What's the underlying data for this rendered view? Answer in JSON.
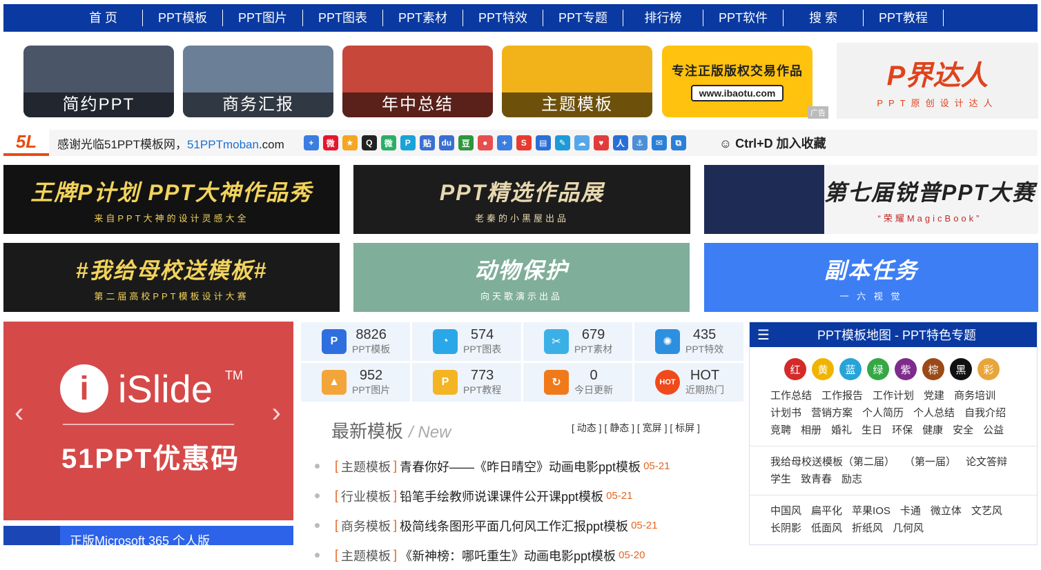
{
  "nav": [
    "首 页",
    "PPT模板",
    "PPT图片",
    "PPT图表",
    "PPT素材",
    "PPT特效",
    "PPT专题",
    "排行榜",
    "PPT软件",
    "搜 索",
    "PPT教程"
  ],
  "promos": [
    {
      "caption": "简约PPT",
      "color": "#4a5568"
    },
    {
      "caption": "商务汇报",
      "color": "#6b7f96"
    },
    {
      "caption": "年中总结",
      "color": "#c7473b"
    },
    {
      "caption": "主题模板",
      "color": "#f2b31a"
    }
  ],
  "ibaotu": {
    "title": "专注正版版权交易作品",
    "url": "www.ibaotu.com",
    "ad": "广告"
  },
  "pjdr": {
    "logo": "P界达人",
    "sub": "PPT原创设计达人"
  },
  "welcome": {
    "logo": "5L",
    "text": "感谢光临51PPT模板网，",
    "domain_colored": "51PPTmoban",
    "domain_tail": ".com",
    "favorite": "Ctrl+D 加入收藏"
  },
  "share_icons": [
    {
      "name": "plus-icon",
      "glyph": "+",
      "color": "#3b7de0"
    },
    {
      "name": "weibo-icon",
      "glyph": "微",
      "color": "#e6162d"
    },
    {
      "name": "star-icon",
      "glyph": "★",
      "color": "#f5a623"
    },
    {
      "name": "qq-icon",
      "glyph": "Q",
      "color": "#222"
    },
    {
      "name": "wechat-icon",
      "glyph": "微",
      "color": "#2aae67"
    },
    {
      "name": "p-icon",
      "glyph": "P",
      "color": "#1aa3d8"
    },
    {
      "name": "tieba-icon",
      "glyph": "贴",
      "color": "#3a6fd1"
    },
    {
      "name": "baidu-icon",
      "glyph": "du",
      "color": "#3a6fd1"
    },
    {
      "name": "douban-icon",
      "glyph": "豆",
      "color": "#2e963d"
    },
    {
      "name": "flower-icon",
      "glyph": "●",
      "color": "#e94e4e"
    },
    {
      "name": "plus2-icon",
      "glyph": "+",
      "color": "#3b7de0"
    },
    {
      "name": "s-icon",
      "glyph": "S",
      "color": "#e83b2f"
    },
    {
      "name": "news-icon",
      "glyph": "▤",
      "color": "#2b6fd6"
    },
    {
      "name": "note-icon",
      "glyph": "✎",
      "color": "#1c9bd8"
    },
    {
      "name": "cloud-icon",
      "glyph": "☁",
      "color": "#56a7e8"
    },
    {
      "name": "heart-icon",
      "glyph": "♥",
      "color": "#e23b3b"
    },
    {
      "name": "people-icon",
      "glyph": "人",
      "color": "#2a6fd6"
    },
    {
      "name": "anchor-icon",
      "glyph": "⚓",
      "color": "#4c8fd8"
    },
    {
      "name": "mail-icon",
      "glyph": "✉",
      "color": "#2b7fd8"
    },
    {
      "name": "copy-icon",
      "glyph": "⧉",
      "color": "#2b7fd8"
    }
  ],
  "banners": [
    {
      "title": "王牌P计划 PPT大神作品秀",
      "sub": "来自PPT大神的设计灵感大全",
      "bg": "#121212",
      "fg": "#f2d35c"
    },
    {
      "title": "PPT精选作品展",
      "sub": "老秦的小黑屋出品",
      "bg": "#1c1c1c",
      "fg": "#e8d8b0"
    },
    {
      "title": "第七届锐普PPT大赛",
      "sub": "“荣耀MagicBook”",
      "bg": "#1e2c55",
      "fg": "#222"
    },
    {
      "title": "#我给母校送模板#",
      "sub": "第二届高校PPT模板设计大赛",
      "bg": "#1a1a1a",
      "fg": "#f2d35c"
    },
    {
      "title": "动物保护",
      "sub": "向天歌演示出品",
      "bg": "#7fae9a",
      "fg": "#ffffff"
    },
    {
      "title": "副本任务",
      "sub": "一  六  视  觉",
      "bg": "#3d7ef5",
      "fg": "#ffffff"
    }
  ],
  "islide": {
    "name": "iSlide",
    "tm": "TM",
    "code": "51PPT优惠码",
    "left": "‹",
    "right": "›"
  },
  "ms": {
    "text": "正版Microsoft 365 个人版"
  },
  "stats": [
    {
      "num": "8826",
      "label": "PPT模板",
      "icon": "ppt-icon",
      "glyph": "P",
      "color": "#2e6fe0"
    },
    {
      "num": "574",
      "label": "PPT图表",
      "icon": "pie-chart-icon",
      "glyph": "◔",
      "color": "#2aa7e8"
    },
    {
      "num": "679",
      "label": "PPT素材",
      "icon": "material-icon",
      "glyph": "✂",
      "color": "#3bb0e6"
    },
    {
      "num": "435",
      "label": "PPT特效",
      "icon": "effect-icon",
      "glyph": "✺",
      "color": "#2d8fe0"
    },
    {
      "num": "952",
      "label": "PPT图片",
      "icon": "image-icon",
      "glyph": "▲",
      "color": "#f3a53a"
    },
    {
      "num": "773",
      "label": "PPT教程",
      "icon": "tutorial-icon",
      "glyph": "P",
      "color": "#f4b524"
    },
    {
      "num": "0",
      "label": "今日更新",
      "icon": "refresh-icon",
      "glyph": "↻",
      "color": "#f07a1a"
    },
    {
      "num": "HOT",
      "label": "近期热门",
      "icon": "hot-icon",
      "glyph": "HOT",
      "color": "#f04a1a"
    }
  ],
  "latest": {
    "title": "最新模板",
    "new": "New",
    "filters": "[ 动态 ] [ 静态 ] [ 宽屏 ] [ 标屏 ]"
  },
  "news": [
    {
      "cat": "主题模板",
      "title": "青春你好——《昨日晴空》动画电影ppt模板",
      "date": "05-21"
    },
    {
      "cat": "行业模板",
      "title": "铅笔手绘教师说课课件公开课ppt模板",
      "date": "05-21"
    },
    {
      "cat": "商务模板",
      "title": "极简线条图形平面几何风工作汇报ppt模板",
      "date": "05-21"
    },
    {
      "cat": "主题模板",
      "title": "《新神榜：哪吒重生》动画电影ppt模板",
      "date": "05-20"
    }
  ],
  "side": {
    "title": "PPT模板地图 - PPT特色专题",
    "colors": [
      {
        "label": "红",
        "color": "#d42a2a"
      },
      {
        "label": "黄",
        "color": "#f0b400"
      },
      {
        "label": "蓝",
        "color": "#27a3d8"
      },
      {
        "label": "绿",
        "color": "#35a845"
      },
      {
        "label": "紫",
        "color": "#7d2b8c"
      },
      {
        "label": "棕",
        "color": "#9b4a17"
      },
      {
        "label": "黑",
        "color": "#111111"
      },
      {
        "label": "彩",
        "color": "#e8a53b"
      }
    ],
    "tags1": [
      "工作总结",
      "工作报告",
      "工作计划",
      "党建",
      "商务培训",
      "计划书",
      "营销方案",
      "个人简历",
      "个人总结",
      "自我介绍",
      "竞聘",
      "相册",
      "婚礼",
      "生日",
      "环保",
      "健康",
      "安全",
      "公益"
    ],
    "tags2": [
      "我给母校送模板（第二届）",
      "（第一届）",
      "论文答辩",
      "学生",
      "致青春",
      "励志"
    ],
    "tags3": [
      "中国风",
      "扁平化",
      "苹果IOS",
      "卡通",
      "微立体",
      "文艺风",
      "长阴影",
      "低面风",
      "折纸风",
      "几何风"
    ]
  }
}
